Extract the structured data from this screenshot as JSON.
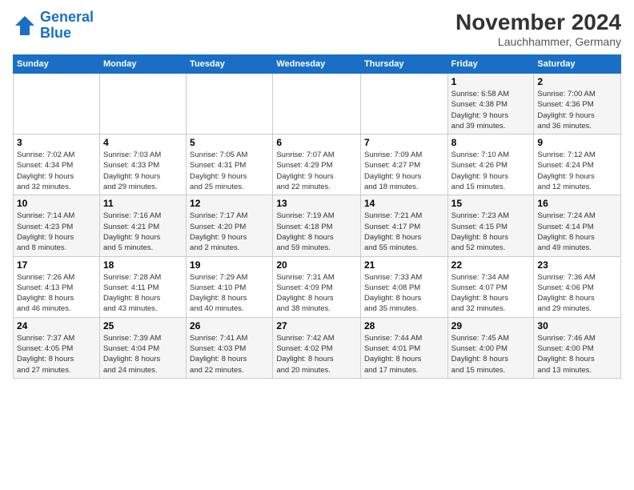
{
  "header": {
    "logo_line1": "General",
    "logo_line2": "Blue",
    "main_title": "November 2024",
    "subtitle": "Lauchhammer, Germany"
  },
  "days_of_week": [
    "Sunday",
    "Monday",
    "Tuesday",
    "Wednesday",
    "Thursday",
    "Friday",
    "Saturday"
  ],
  "weeks": [
    [
      {
        "day": "",
        "info": ""
      },
      {
        "day": "",
        "info": ""
      },
      {
        "day": "",
        "info": ""
      },
      {
        "day": "",
        "info": ""
      },
      {
        "day": "",
        "info": ""
      },
      {
        "day": "1",
        "info": "Sunrise: 6:58 AM\nSunset: 4:38 PM\nDaylight: 9 hours\nand 39 minutes."
      },
      {
        "day": "2",
        "info": "Sunrise: 7:00 AM\nSunset: 4:36 PM\nDaylight: 9 hours\nand 36 minutes."
      }
    ],
    [
      {
        "day": "3",
        "info": "Sunrise: 7:02 AM\nSunset: 4:34 PM\nDaylight: 9 hours\nand 32 minutes."
      },
      {
        "day": "4",
        "info": "Sunrise: 7:03 AM\nSunset: 4:33 PM\nDaylight: 9 hours\nand 29 minutes."
      },
      {
        "day": "5",
        "info": "Sunrise: 7:05 AM\nSunset: 4:31 PM\nDaylight: 9 hours\nand 25 minutes."
      },
      {
        "day": "6",
        "info": "Sunrise: 7:07 AM\nSunset: 4:29 PM\nDaylight: 9 hours\nand 22 minutes."
      },
      {
        "day": "7",
        "info": "Sunrise: 7:09 AM\nSunset: 4:27 PM\nDaylight: 9 hours\nand 18 minutes."
      },
      {
        "day": "8",
        "info": "Sunrise: 7:10 AM\nSunset: 4:26 PM\nDaylight: 9 hours\nand 15 minutes."
      },
      {
        "day": "9",
        "info": "Sunrise: 7:12 AM\nSunset: 4:24 PM\nDaylight: 9 hours\nand 12 minutes."
      }
    ],
    [
      {
        "day": "10",
        "info": "Sunrise: 7:14 AM\nSunset: 4:23 PM\nDaylight: 9 hours\nand 8 minutes."
      },
      {
        "day": "11",
        "info": "Sunrise: 7:16 AM\nSunset: 4:21 PM\nDaylight: 9 hours\nand 5 minutes."
      },
      {
        "day": "12",
        "info": "Sunrise: 7:17 AM\nSunset: 4:20 PM\nDaylight: 9 hours\nand 2 minutes."
      },
      {
        "day": "13",
        "info": "Sunrise: 7:19 AM\nSunset: 4:18 PM\nDaylight: 8 hours\nand 59 minutes."
      },
      {
        "day": "14",
        "info": "Sunrise: 7:21 AM\nSunset: 4:17 PM\nDaylight: 8 hours\nand 55 minutes."
      },
      {
        "day": "15",
        "info": "Sunrise: 7:23 AM\nSunset: 4:15 PM\nDaylight: 8 hours\nand 52 minutes."
      },
      {
        "day": "16",
        "info": "Sunrise: 7:24 AM\nSunset: 4:14 PM\nDaylight: 8 hours\nand 49 minutes."
      }
    ],
    [
      {
        "day": "17",
        "info": "Sunrise: 7:26 AM\nSunset: 4:13 PM\nDaylight: 8 hours\nand 46 minutes."
      },
      {
        "day": "18",
        "info": "Sunrise: 7:28 AM\nSunset: 4:11 PM\nDaylight: 8 hours\nand 43 minutes."
      },
      {
        "day": "19",
        "info": "Sunrise: 7:29 AM\nSunset: 4:10 PM\nDaylight: 8 hours\nand 40 minutes."
      },
      {
        "day": "20",
        "info": "Sunrise: 7:31 AM\nSunset: 4:09 PM\nDaylight: 8 hours\nand 38 minutes."
      },
      {
        "day": "21",
        "info": "Sunrise: 7:33 AM\nSunset: 4:08 PM\nDaylight: 8 hours\nand 35 minutes."
      },
      {
        "day": "22",
        "info": "Sunrise: 7:34 AM\nSunset: 4:07 PM\nDaylight: 8 hours\nand 32 minutes."
      },
      {
        "day": "23",
        "info": "Sunrise: 7:36 AM\nSunset: 4:06 PM\nDaylight: 8 hours\nand 29 minutes."
      }
    ],
    [
      {
        "day": "24",
        "info": "Sunrise: 7:37 AM\nSunset: 4:05 PM\nDaylight: 8 hours\nand 27 minutes."
      },
      {
        "day": "25",
        "info": "Sunrise: 7:39 AM\nSunset: 4:04 PM\nDaylight: 8 hours\nand 24 minutes."
      },
      {
        "day": "26",
        "info": "Sunrise: 7:41 AM\nSunset: 4:03 PM\nDaylight: 8 hours\nand 22 minutes."
      },
      {
        "day": "27",
        "info": "Sunrise: 7:42 AM\nSunset: 4:02 PM\nDaylight: 8 hours\nand 20 minutes."
      },
      {
        "day": "28",
        "info": "Sunrise: 7:44 AM\nSunset: 4:01 PM\nDaylight: 8 hours\nand 17 minutes."
      },
      {
        "day": "29",
        "info": "Sunrise: 7:45 AM\nSunset: 4:00 PM\nDaylight: 8 hours\nand 15 minutes."
      },
      {
        "day": "30",
        "info": "Sunrise: 7:46 AM\nSunset: 4:00 PM\nDaylight: 8 hours\nand 13 minutes."
      }
    ]
  ]
}
